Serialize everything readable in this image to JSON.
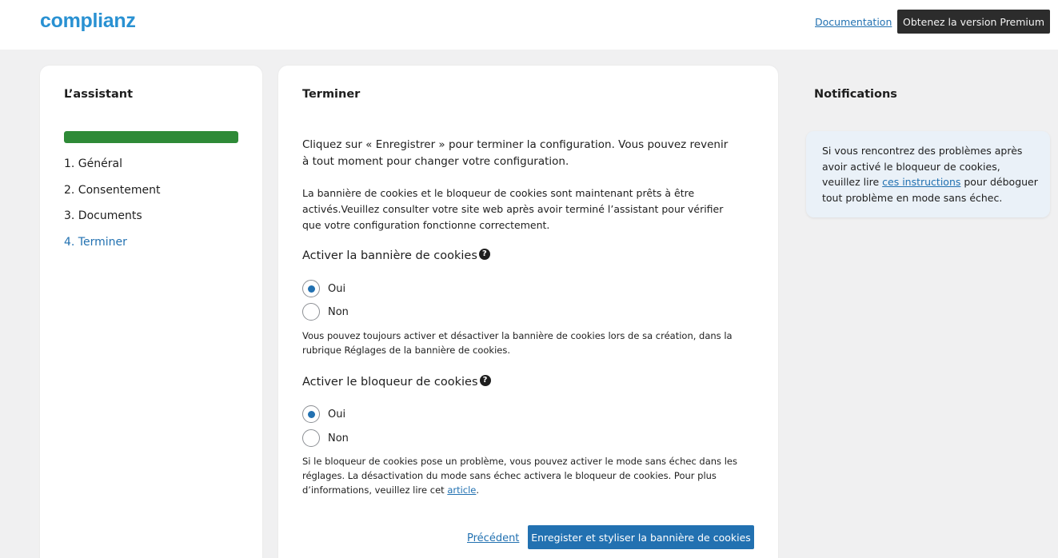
{
  "header": {
    "logo_text": "complianz",
    "documentation_link": "Documentation",
    "premium_button": "Obtenez la version Premium"
  },
  "wizard": {
    "title": "L’assistant",
    "progress": 1.0,
    "steps": [
      {
        "label": "1. Général",
        "active": false
      },
      {
        "label": "2. Consentement",
        "active": false
      },
      {
        "label": "3. Documents",
        "active": false
      },
      {
        "label": "4. Terminer",
        "active": true
      }
    ]
  },
  "main": {
    "title": "Terminer",
    "intro": "Cliquez sur « Enregistrer » pour terminer la configuration. Vous pouvez revenir à tout moment pour changer votre configuration.",
    "intro2": "La bannière de cookies et le bloqueur de cookies sont maintenant prêts à être activés.Veuillez consulter votre site web après avoir terminé l’assistant pour vérifier que votre configuration fonctionne correctement.",
    "banner_field": {
      "label": "Activer la bannière de cookies",
      "options": [
        "Oui",
        "Non"
      ],
      "selected": "Oui",
      "help": "Vous pouvez toujours activer et désactiver la bannière de cookies lors de sa création, dans la rubrique Réglages de la bannière de cookies."
    },
    "blocker_field": {
      "label": "Activer le bloqueur de cookies",
      "options": [
        "Oui",
        "Non"
      ],
      "selected": "Oui",
      "help_before": "Si le bloqueur de cookies pose un problème, vous pouvez activer le mode sans échec dans les réglages. La désactivation du mode sans échec activera le bloqueur de cookies. Pour plus d’informations, veuillez lire cet ",
      "help_link": "article",
      "help_after": "."
    },
    "previous_link": "Précédent",
    "save_button": "Enregister et styliser la bannière de cookies"
  },
  "notifications": {
    "title": "Notifications",
    "text_before": "Si vous rencontrez des problèmes après avoir activé le bloqueur de cookies, veuillez lire ",
    "link": "ces instructions",
    "text_after": " pour déboguer tout problème en mode sans échec."
  },
  "colors": {
    "brand": "#2991d2",
    "accent": "#2271b1",
    "progress": "#2e8a37",
    "notice_bg": "#eaf1f8"
  }
}
